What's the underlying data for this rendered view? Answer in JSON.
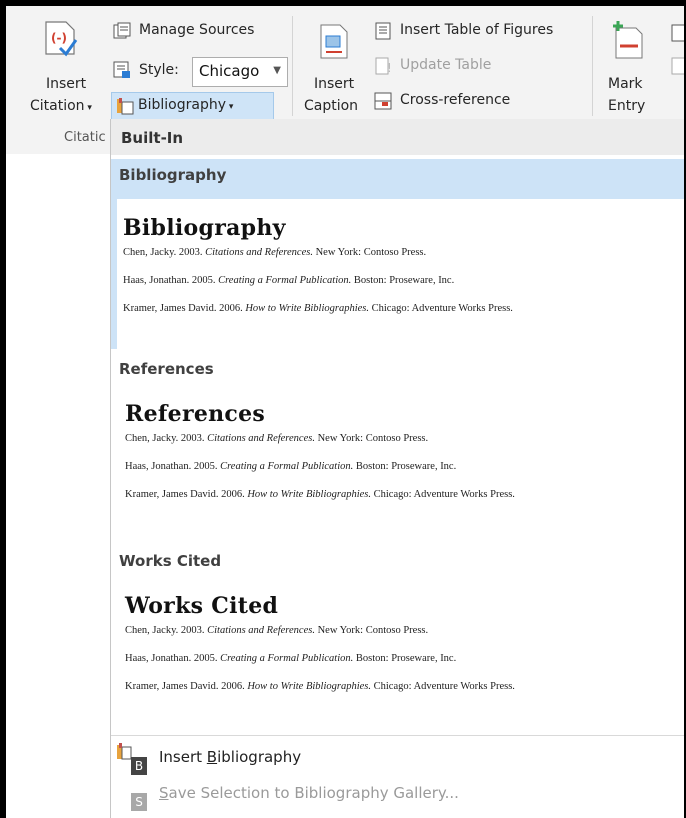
{
  "ribbon": {
    "insert_citation_line1": "Insert",
    "insert_citation_line2": "Citation",
    "manage_sources": "Manage Sources",
    "style_label": "Style:",
    "style_value": "Chicago",
    "bibliography": "Bibliography",
    "group_citations": "Citatic",
    "insert_caption_line1": "Insert",
    "insert_caption_line2": "Caption",
    "insert_table_of_figures": "Insert Table of Figures",
    "update_table": "Update Table",
    "cross_reference": "Cross-reference",
    "mark_entry_line1": "Mark",
    "mark_entry_line2": "Entry"
  },
  "gallery": {
    "header": "Built-In",
    "items": [
      {
        "category": "Bibliography",
        "title": "Bibliography",
        "lines": [
          {
            "pre": "Chen, Jacky. 2003. ",
            "italic": "Citations and References.",
            "post": " New York: Contoso Press."
          },
          {
            "pre": "Haas, Jonathan. 2005. ",
            "italic": "Creating a Formal Publication.",
            "post": " Boston: Proseware, Inc."
          },
          {
            "pre": "Kramer, James David. 2006. ",
            "italic": "How to Write Bibliographies.",
            "post": "  Chicago: Adventure Works Press."
          }
        ]
      },
      {
        "category": "References",
        "title": "References",
        "lines": [
          {
            "pre": "Chen, Jacky. 2003. ",
            "italic": "Citations and References.",
            "post": " New York: Contoso Press."
          },
          {
            "pre": "Haas, Jonathan. 2005. ",
            "italic": "Creating a Formal Publication.",
            "post": " Boston: Proseware, Inc."
          },
          {
            "pre": "Kramer, James David. 2006. ",
            "italic": "How to Write Bibliographies.",
            "post": "  Chicago: Adventure Works Press."
          }
        ]
      },
      {
        "category": "Works Cited",
        "title": "Works Cited",
        "lines": [
          {
            "pre": "Chen, Jacky. 2003. ",
            "italic": "Citations and References.",
            "post": " New York: Contoso Press."
          },
          {
            "pre": "Haas, Jonathan. 2005. ",
            "italic": "Creating a Formal Publication.",
            "post": " Boston: Proseware, Inc."
          },
          {
            "pre": "Kramer, James David. 2006. ",
            "italic": "How to Write Bibliographies.",
            "post": "  Chicago: Adventure Works Press."
          }
        ]
      }
    ],
    "menu": {
      "insert_bibliography": {
        "before": "Insert ",
        "accel": "B",
        "after": "ibliography",
        "keytip": "B"
      },
      "save_selection": {
        "before": "",
        "accel": "S",
        "after": "ave Selection to Bibliography Gallery...",
        "keytip": "S"
      }
    }
  }
}
